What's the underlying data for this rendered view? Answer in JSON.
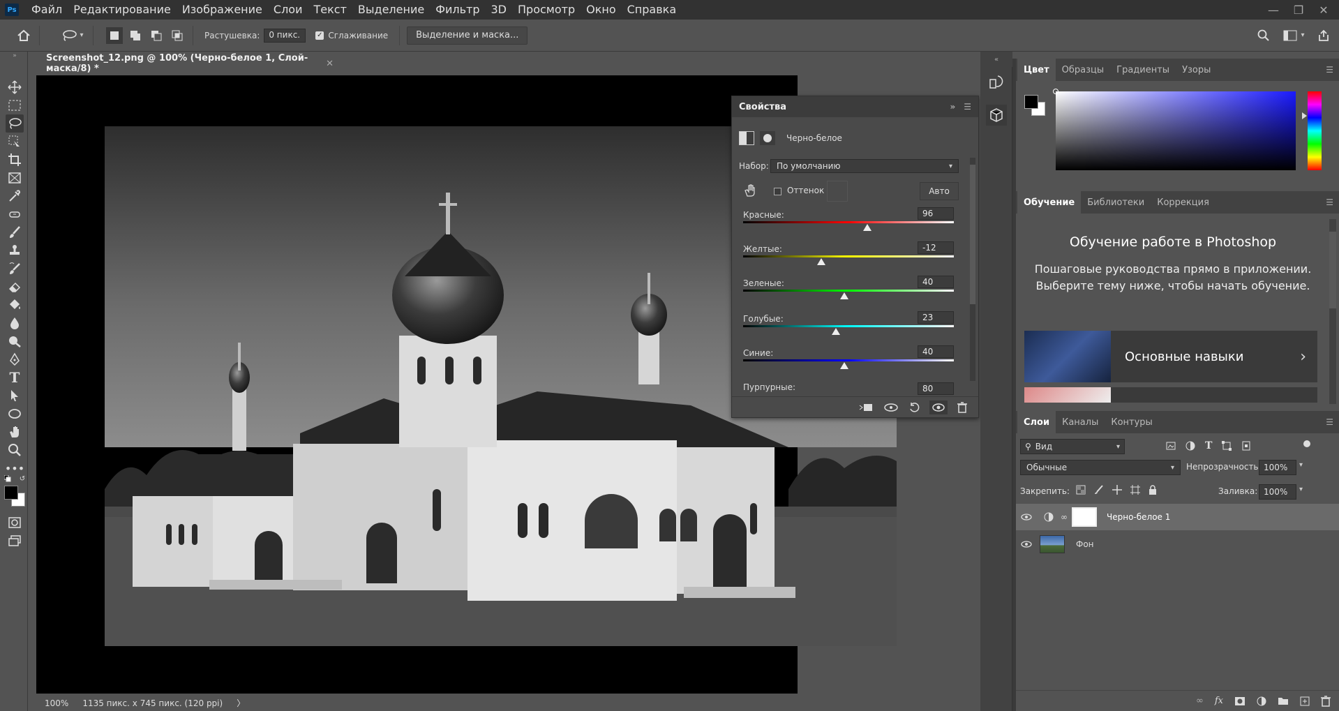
{
  "menu": [
    "Файл",
    "Редактирование",
    "Изображение",
    "Слои",
    "Текст",
    "Выделение",
    "Фильтр",
    "3D",
    "Просмотр",
    "Окно",
    "Справка"
  ],
  "app_logo": "Ps",
  "options": {
    "feather_label": "Растушевка:",
    "feather_value": "0 пикс.",
    "antialias_label": "Сглаживание",
    "select_mask_button": "Выделение и маска..."
  },
  "document": {
    "tab_title": "Screenshot_12.png @ 100% (Черно-белое 1, Слой-маска/8) *",
    "status_zoom": "100%",
    "status_info": "1135 пикс. x 745 пикс. (120 ppi)",
    "status_arrow": "〉"
  },
  "properties": {
    "title": "Свойства",
    "subtitle": "Черно-белое",
    "preset_label": "Набор:",
    "preset_value": "По умолчанию",
    "tint_label": "Оттенок",
    "auto_button": "Авто",
    "sliders": [
      {
        "label": "Красные:",
        "value": "96",
        "fraction": 0.59
      },
      {
        "label": "Желтые:",
        "value": "-12",
        "fraction": 0.37
      },
      {
        "label": "Зеленые:",
        "value": "40",
        "fraction": 0.48
      },
      {
        "label": "Голубые:",
        "value": "23",
        "fraction": 0.44
      },
      {
        "label": "Синие:",
        "value": "40",
        "fraction": 0.48
      },
      {
        "label": "Пурпурные:",
        "value": "80",
        "fraction": 0.56
      }
    ]
  },
  "color_panel": {
    "tabs": [
      "Цвет",
      "Образцы",
      "Градиенты",
      "Узоры"
    ],
    "foreground": "#000000",
    "background": "#ffffff",
    "hue_color": "#1a1aff"
  },
  "learn_panel": {
    "tabs": [
      "Обучение",
      "Библиотеки",
      "Коррекция"
    ],
    "heading": "Обучение работе в Photoshop",
    "description": "Пошаговые руководства прямо в приложении. Выберите тему ниже, чтобы начать обучение.",
    "card_title": "Основные навыки"
  },
  "layers_panel": {
    "tabs": [
      "Слои",
      "Каналы",
      "Контуры"
    ],
    "filter_value": "Вид",
    "blend_mode": "Обычные",
    "opacity_label": "Непрозрачность:",
    "opacity_value": "100%",
    "lock_label": "Закрепить:",
    "fill_label": "Заливка:",
    "fill_value": "100%",
    "layers": [
      {
        "name": "Черно-белое 1"
      },
      {
        "name": "Фон"
      }
    ]
  }
}
